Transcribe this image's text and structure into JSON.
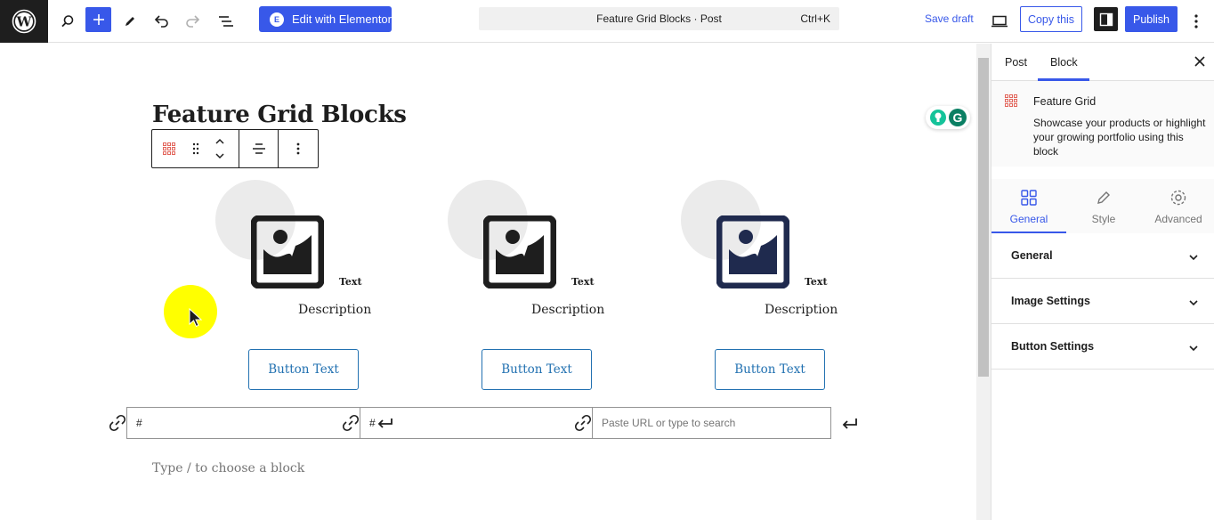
{
  "topbar": {
    "elementor_label": "Edit with Elementor",
    "command_title": "Feature Grid Blocks · Post",
    "command_shortcut": "Ctrl+K",
    "save_draft": "Save draft",
    "copy_label": "Copy this",
    "publish_label": "Publish",
    "icons": [
      "wordpress-logo",
      "search-icon",
      "plus-icon",
      "pencil-icon",
      "undo-icon",
      "redo-icon",
      "list-view-icon",
      "desktop-icon",
      "settings-icon",
      "more-vertical-icon"
    ]
  },
  "editor": {
    "post_title": "Feature Grid Blocks",
    "type_hint": "Type / to choose a block",
    "features": [
      {
        "text": "Text",
        "description": "Description",
        "button": "Button Text",
        "icon_color": "#1e1e1e"
      },
      {
        "text": "Text",
        "description": "Description",
        "button": "Button Text",
        "icon_color": "#1e1e1e"
      },
      {
        "text": "Text",
        "description": "Description",
        "button": "Button Text",
        "icon_color": "#1f2a4e"
      }
    ],
    "link_fields": [
      {
        "value": "#",
        "placeholder": ""
      },
      {
        "value": "#",
        "placeholder": ""
      },
      {
        "value": "",
        "placeholder": "Paste URL or type to search"
      }
    ]
  },
  "sidebar": {
    "tabs": [
      "Post",
      "Block"
    ],
    "active_tab": "Block",
    "block_name": "Feature Grid",
    "block_description": "Showcase your products or highlight your growing portfolio using this block",
    "sub_tabs": [
      "General",
      "Style",
      "Advanced"
    ],
    "active_sub_tab": "General",
    "panels": [
      "General",
      "Image Settings",
      "Button Settings"
    ]
  },
  "colors": {
    "accent": "#3858e9",
    "button_border": "#2271b1",
    "placeholder_circle": "#ebebeb",
    "cursor_highlight": "#ffff00"
  }
}
